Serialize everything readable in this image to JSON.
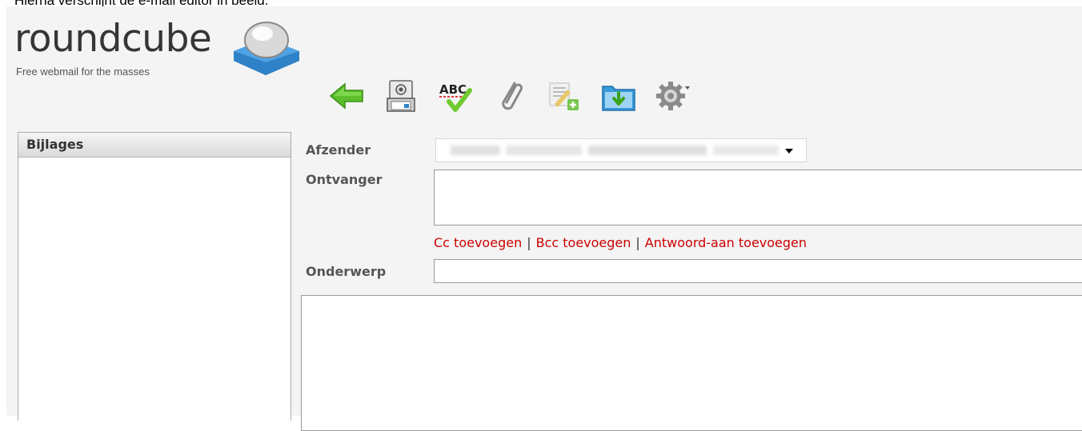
{
  "caption": "Hierna verschijnt de e-mail editor in beeld.",
  "logo": {
    "name": "roundcube",
    "tagline": "Free webmail for the masses"
  },
  "toolbar": {
    "buttons": [
      {
        "name": "back",
        "icon": "back-arrow-icon"
      },
      {
        "name": "send",
        "icon": "send-mail-icon"
      },
      {
        "name": "spellcheck",
        "icon": "spellcheck-icon",
        "label": "ABC"
      },
      {
        "name": "attach",
        "icon": "paperclip-icon"
      },
      {
        "name": "signature",
        "icon": "signature-icon"
      },
      {
        "name": "save",
        "icon": "save-folder-icon"
      },
      {
        "name": "options",
        "icon": "gear-icon"
      }
    ]
  },
  "attachments": {
    "title": "Bijlages"
  },
  "compose": {
    "from_label": "Afzender",
    "to_label": "Ontvanger",
    "subject_label": "Onderwerp",
    "to_value": "",
    "subject_value": "",
    "body_value": "",
    "add_cc": "Cc toevoegen",
    "add_bcc": "Bcc toevoegen",
    "add_replyto": "Antwoord-aan toevoegen",
    "separator": "|"
  },
  "colors": {
    "link": "#cc0000",
    "background": "#f4f4f4",
    "accent_cube": "#2f82c8",
    "arrow_green": "#5cbf2a"
  }
}
